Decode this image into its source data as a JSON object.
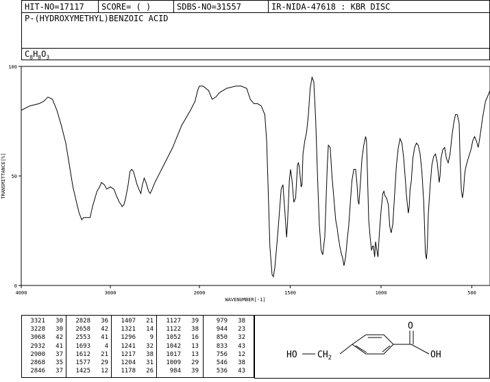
{
  "header": {
    "hit_no": "HIT-NO=17117",
    "score": "SCORE=  (   )",
    "sdbs_no": "SDBS-NO=31557",
    "ir_info": "IR-NIDA-47618 : KBR DISC"
  },
  "compound": {
    "name": "P-(HYDROXYMETHYL)BENZOIC ACID",
    "formula_parts": [
      "C",
      "8",
      "H",
      "8",
      "O",
      "3"
    ]
  },
  "chart_data": {
    "type": "line",
    "xlabel": "WAVENUMBER[-1]",
    "ylabel": "TRANSMITTANCE[%]",
    "xlim": [
      4000,
      400
    ],
    "ylim": [
      0,
      100
    ],
    "x_ticks": [
      "4000",
      "3000",
      "2000",
      "1500",
      "1000",
      "500"
    ],
    "y_ticks": [
      "100",
      "50",
      "0"
    ],
    "grid": false,
    "series": [
      {
        "points": [
          [
            4000,
            80
          ],
          [
            3900,
            82
          ],
          [
            3800,
            83
          ],
          [
            3750,
            84
          ],
          [
            3700,
            86
          ],
          [
            3650,
            85
          ],
          [
            3600,
            80
          ],
          [
            3550,
            73
          ],
          [
            3500,
            65
          ],
          [
            3460,
            55
          ],
          [
            3420,
            45
          ],
          [
            3380,
            38
          ],
          [
            3350,
            33
          ],
          [
            3321,
            30
          ],
          [
            3300,
            31
          ],
          [
            3260,
            31
          ],
          [
            3228,
            31
          ],
          [
            3200,
            36
          ],
          [
            3150,
            43
          ],
          [
            3120,
            45
          ],
          [
            3100,
            47
          ],
          [
            3068,
            46
          ],
          [
            3040,
            44
          ],
          [
            3000,
            45
          ],
          [
            2960,
            44
          ],
          [
            2932,
            41
          ],
          [
            2910,
            39
          ],
          [
            2900,
            38
          ],
          [
            2880,
            37
          ],
          [
            2868,
            36
          ],
          [
            2846,
            37
          ],
          [
            2828,
            40
          ],
          [
            2800,
            46
          ],
          [
            2780,
            52
          ],
          [
            2760,
            53
          ],
          [
            2740,
            52
          ],
          [
            2700,
            46
          ],
          [
            2680,
            44
          ],
          [
            2658,
            42
          ],
          [
            2640,
            46
          ],
          [
            2620,
            49
          ],
          [
            2600,
            47
          ],
          [
            2570,
            43
          ],
          [
            2553,
            42
          ],
          [
            2530,
            44
          ],
          [
            2500,
            47
          ],
          [
            2450,
            51
          ],
          [
            2400,
            55
          ],
          [
            2300,
            63
          ],
          [
            2200,
            73
          ],
          [
            2100,
            80
          ],
          [
            2050,
            84
          ],
          [
            2020,
            89
          ],
          [
            2000,
            91
          ],
          [
            1980,
            91
          ],
          [
            1950,
            89
          ],
          [
            1930,
            85
          ],
          [
            1910,
            86
          ],
          [
            1890,
            88
          ],
          [
            1850,
            90
          ],
          [
            1800,
            91
          ],
          [
            1770,
            91
          ],
          [
            1740,
            90
          ],
          [
            1720,
            85
          ],
          [
            1700,
            83
          ],
          [
            1680,
            83
          ],
          [
            1660,
            82
          ],
          [
            1640,
            78
          ],
          [
            1630,
            66
          ],
          [
            1620,
            40
          ],
          [
            1612,
            18
          ],
          [
            1605,
            10
          ],
          [
            1600,
            5
          ],
          [
            1593,
            4
          ],
          [
            1585,
            8
          ],
          [
            1570,
            22
          ],
          [
            1560,
            33
          ],
          [
            1550,
            44
          ],
          [
            1540,
            46
          ],
          [
            1530,
            34
          ],
          [
            1520,
            22
          ],
          [
            1515,
            28
          ],
          [
            1505,
            48
          ],
          [
            1498,
            53
          ],
          [
            1490,
            48
          ],
          [
            1480,
            38
          ],
          [
            1470,
            40
          ],
          [
            1460,
            55
          ],
          [
            1455,
            56
          ],
          [
            1450,
            54
          ],
          [
            1440,
            45
          ],
          [
            1435,
            46
          ],
          [
            1430,
            60
          ],
          [
            1420,
            66
          ],
          [
            1410,
            70
          ],
          [
            1400,
            78
          ],
          [
            1390,
            90
          ],
          [
            1380,
            95
          ],
          [
            1370,
            93
          ],
          [
            1360,
            76
          ],
          [
            1350,
            50
          ],
          [
            1340,
            28
          ],
          [
            1330,
            16
          ],
          [
            1321,
            14
          ],
          [
            1310,
            22
          ],
          [
            1300,
            45
          ],
          [
            1296,
            55
          ],
          [
            1290,
            64
          ],
          [
            1280,
            63
          ],
          [
            1270,
            50
          ],
          [
            1260,
            40
          ],
          [
            1250,
            30
          ],
          [
            1241,
            26
          ],
          [
            1235,
            22
          ],
          [
            1225,
            17
          ],
          [
            1217,
            14
          ],
          [
            1212,
            13
          ],
          [
            1204,
            9
          ],
          [
            1195,
            13
          ],
          [
            1185,
            22
          ],
          [
            1178,
            27
          ],
          [
            1170,
            37
          ],
          [
            1160,
            48
          ],
          [
            1150,
            53
          ],
          [
            1140,
            53
          ],
          [
            1132,
            46
          ],
          [
            1127,
            39
          ],
          [
            1122,
            37
          ],
          [
            1115,
            45
          ],
          [
            1105,
            58
          ],
          [
            1095,
            64
          ],
          [
            1085,
            68
          ],
          [
            1080,
            66
          ],
          [
            1075,
            52
          ],
          [
            1068,
            30
          ],
          [
            1060,
            22
          ],
          [
            1052,
            16
          ],
          [
            1046,
            18
          ],
          [
            1042,
            18
          ],
          [
            1035,
            13
          ],
          [
            1030,
            20
          ],
          [
            1017,
            13
          ],
          [
            1009,
            24
          ],
          [
            1000,
            34
          ],
          [
            990,
            42
          ],
          [
            984,
            43
          ],
          [
            979,
            41
          ],
          [
            970,
            40
          ],
          [
            960,
            37
          ],
          [
            952,
            27
          ],
          [
            944,
            24
          ],
          [
            935,
            28
          ],
          [
            925,
            42
          ],
          [
            915,
            55
          ],
          [
            905,
            63
          ],
          [
            895,
            67
          ],
          [
            885,
            65
          ],
          [
            875,
            58
          ],
          [
            865,
            47
          ],
          [
            860,
            41
          ],
          [
            850,
            33
          ],
          [
            845,
            36
          ],
          [
            840,
            44
          ],
          [
            833,
            48
          ],
          [
            825,
            58
          ],
          [
            815,
            63
          ],
          [
            805,
            65
          ],
          [
            795,
            64
          ],
          [
            785,
            60
          ],
          [
            775,
            52
          ],
          [
            765,
            38
          ],
          [
            760,
            26
          ],
          [
            756,
            15
          ],
          [
            750,
            12
          ],
          [
            745,
            18
          ],
          [
            740,
            32
          ],
          [
            730,
            45
          ],
          [
            720,
            55
          ],
          [
            710,
            59
          ],
          [
            700,
            60
          ],
          [
            690,
            56
          ],
          [
            680,
            47
          ],
          [
            675,
            50
          ],
          [
            670,
            58
          ],
          [
            660,
            62
          ],
          [
            650,
            63
          ],
          [
            640,
            58
          ],
          [
            630,
            56
          ],
          [
            620,
            60
          ],
          [
            610,
            68
          ],
          [
            600,
            74
          ],
          [
            590,
            78
          ],
          [
            580,
            78
          ],
          [
            570,
            74
          ],
          [
            565,
            58
          ],
          [
            558,
            44
          ],
          [
            552,
            40
          ],
          [
            546,
            43
          ],
          [
            540,
            50
          ],
          [
            536,
            53
          ],
          [
            530,
            55
          ],
          [
            520,
            58
          ],
          [
            505,
            62
          ],
          [
            495,
            66
          ],
          [
            485,
            68
          ],
          [
            475,
            66
          ],
          [
            465,
            63
          ],
          [
            455,
            68
          ],
          [
            440,
            77
          ],
          [
            425,
            84
          ],
          [
            410,
            87
          ],
          [
            400,
            89
          ]
        ]
      }
    ]
  },
  "peak_table": [
    [
      [
        "3321",
        "30"
      ],
      [
        "3228",
        "30"
      ],
      [
        "3068",
        "42"
      ],
      [
        "2932",
        "41"
      ],
      [
        "2900",
        "37"
      ],
      [
        "2868",
        "35"
      ],
      [
        "2846",
        "37"
      ]
    ],
    [
      [
        "2828",
        "36"
      ],
      [
        "2658",
        "42"
      ],
      [
        "2553",
        "41"
      ],
      [
        "1693",
        "4"
      ],
      [
        "1612",
        "21"
      ],
      [
        "1577",
        "29"
      ],
      [
        "1425",
        "12"
      ]
    ],
    [
      [
        "1407",
        "21"
      ],
      [
        "1321",
        "14"
      ],
      [
        "1296",
        "9"
      ],
      [
        "1241",
        "32"
      ],
      [
        "1217",
        "38"
      ],
      [
        "1204",
        "31"
      ],
      [
        "1178",
        "26"
      ]
    ],
    [
      [
        "1127",
        "39"
      ],
      [
        "1122",
        "38"
      ],
      [
        "1052",
        "16"
      ],
      [
        "1042",
        "13"
      ],
      [
        "1017",
        "13"
      ],
      [
        "1009",
        "29"
      ],
      [
        "984",
        "39"
      ]
    ],
    [
      [
        "979",
        "38"
      ],
      [
        "944",
        "23"
      ],
      [
        "850",
        "32"
      ],
      [
        "833",
        "43"
      ],
      [
        "756",
        "12"
      ],
      [
        "546",
        "38"
      ],
      [
        "536",
        "43"
      ]
    ]
  ],
  "structure": {
    "left_group": "HO",
    "ch2": "CH",
    "ch2_sub": "2",
    "carbonyl_o": "O",
    "acid_oh": "OH"
  }
}
